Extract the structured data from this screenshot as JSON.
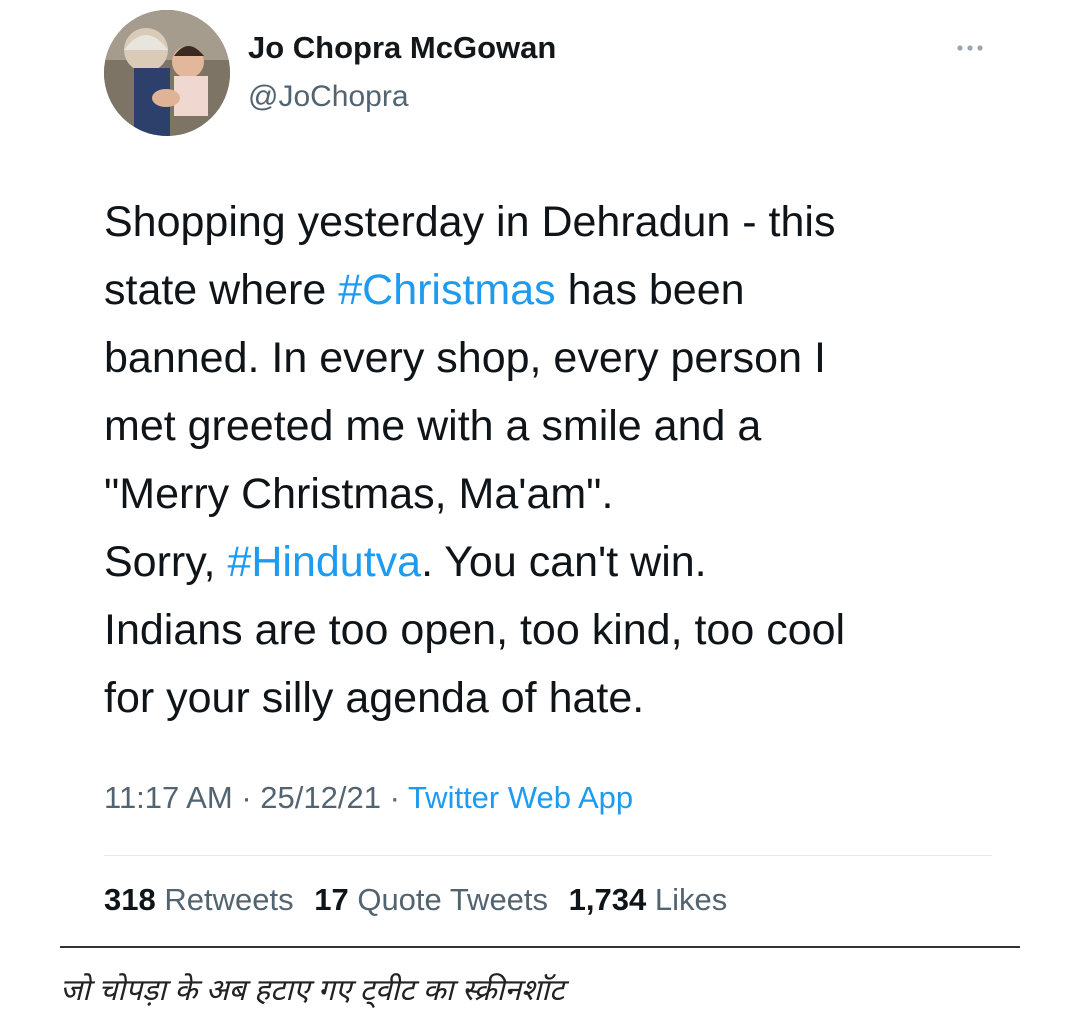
{
  "tweet": {
    "author": {
      "display_name": "Jo Chopra McGowan",
      "handle": "@JoChopra"
    },
    "text_lines": [
      [
        {
          "t": "Shopping yesterday in Dehradun - this"
        }
      ],
      [
        {
          "t": "state where "
        },
        {
          "t": "#Christmas",
          "tag": true
        },
        {
          "t": " has been"
        }
      ],
      [
        {
          "t": "banned. In every shop, every person I"
        }
      ],
      [
        {
          "t": "met greeted me with a smile and a"
        }
      ],
      [
        {
          "t": "\"Merry Christmas, Ma'am\"."
        }
      ],
      [
        {
          "t": "Sorry, "
        },
        {
          "t": "#Hindutva",
          "tag": true
        },
        {
          "t": ". You can't win."
        }
      ],
      [
        {
          "t": "Indians are too open, too kind, too cool"
        }
      ],
      [
        {
          "t": "for your silly agenda of hate."
        }
      ]
    ],
    "time": "11:17 AM",
    "date": "25/12/21",
    "separator": "·",
    "source": "Twitter Web App",
    "stats": {
      "retweets_count": "318",
      "retweets_label": "Retweets",
      "quote_count": "17",
      "quote_label": "Quote Tweets",
      "likes_count": "1,734",
      "likes_label": "Likes"
    }
  },
  "caption": "जो चोपड़ा के अब हटाए गए ट्वीट का स्क्रीनशॉट",
  "icons": {
    "more": "more-options-icon",
    "avatar": "avatar"
  },
  "colors": {
    "link": "#1d9bf0",
    "secondary_text": "#536471",
    "primary_text": "#0f1419"
  }
}
